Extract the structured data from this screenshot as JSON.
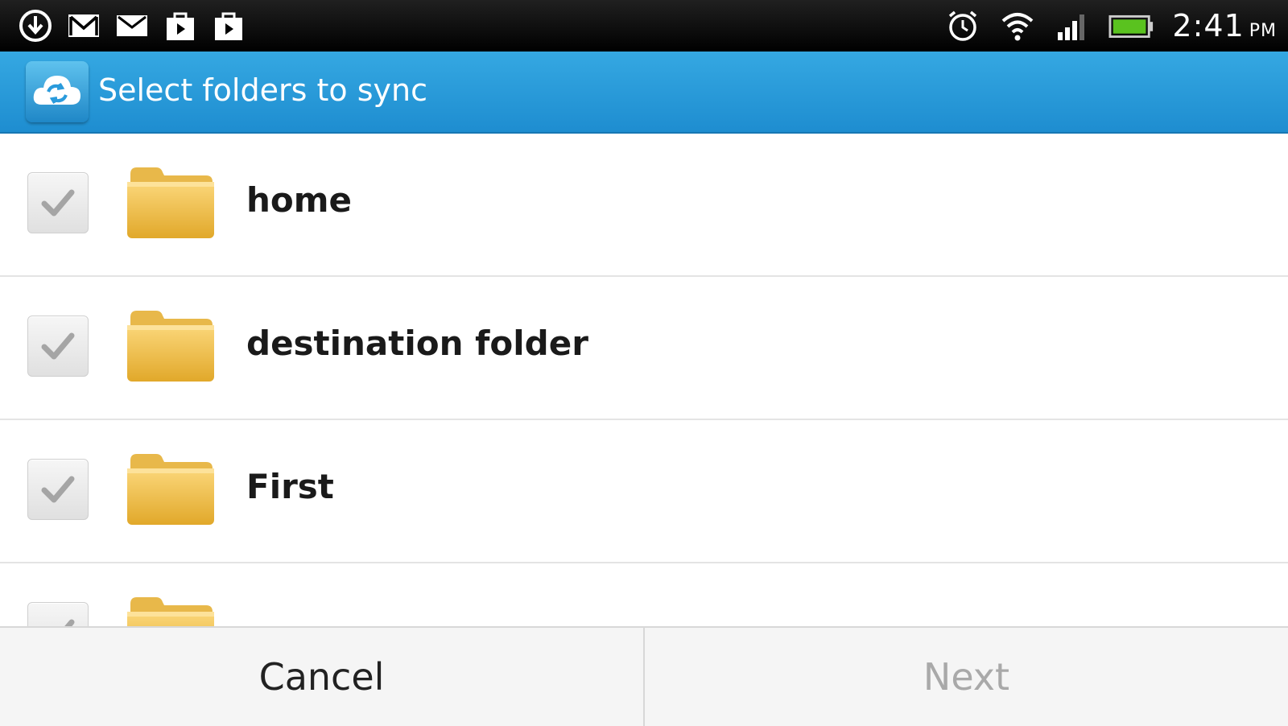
{
  "status_bar": {
    "left_icons": [
      "download-icon",
      "gmail-icon",
      "mail-icon",
      "store-icon",
      "play-store-icon"
    ],
    "right_icons": [
      "alarm-icon",
      "wifi-icon",
      "signal-icon",
      "battery-icon"
    ],
    "time": "2:41",
    "ampm": "PM"
  },
  "action_bar": {
    "app_icon": "cloud-sync-icon",
    "title": "Select folders to sync",
    "color": "#2a9bdc"
  },
  "folders": [
    {
      "name": "home",
      "checked": true
    },
    {
      "name": "destination folder",
      "checked": true
    },
    {
      "name": "First",
      "checked": true
    },
    {
      "name": "",
      "checked": true
    }
  ],
  "buttons": {
    "cancel": "Cancel",
    "next": "Next"
  }
}
